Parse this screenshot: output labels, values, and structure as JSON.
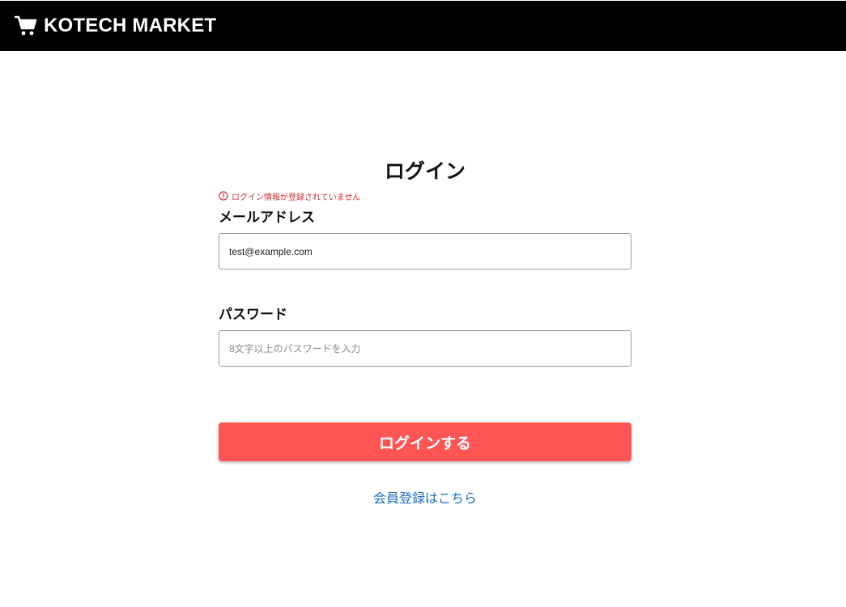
{
  "header": {
    "brand": "KOTECH MARKET",
    "icon": "shopping-cart-icon",
    "background_color": "#000000"
  },
  "login": {
    "title": "ログイン",
    "error_icon": "error-circle-icon",
    "error_message": "ログイン情報が登録されていません",
    "error_color": "#d32f2f",
    "email_label": "メールアドレス",
    "email_value": "test@example.com",
    "password_label": "パスワード",
    "password_placeholder": "8文字以上のパスワードを入力",
    "password_value": "",
    "submit_label": "ログインする",
    "submit_color": "#ff5555",
    "register_link": "会員登録はこちら",
    "link_color": "#1e6fc4"
  }
}
